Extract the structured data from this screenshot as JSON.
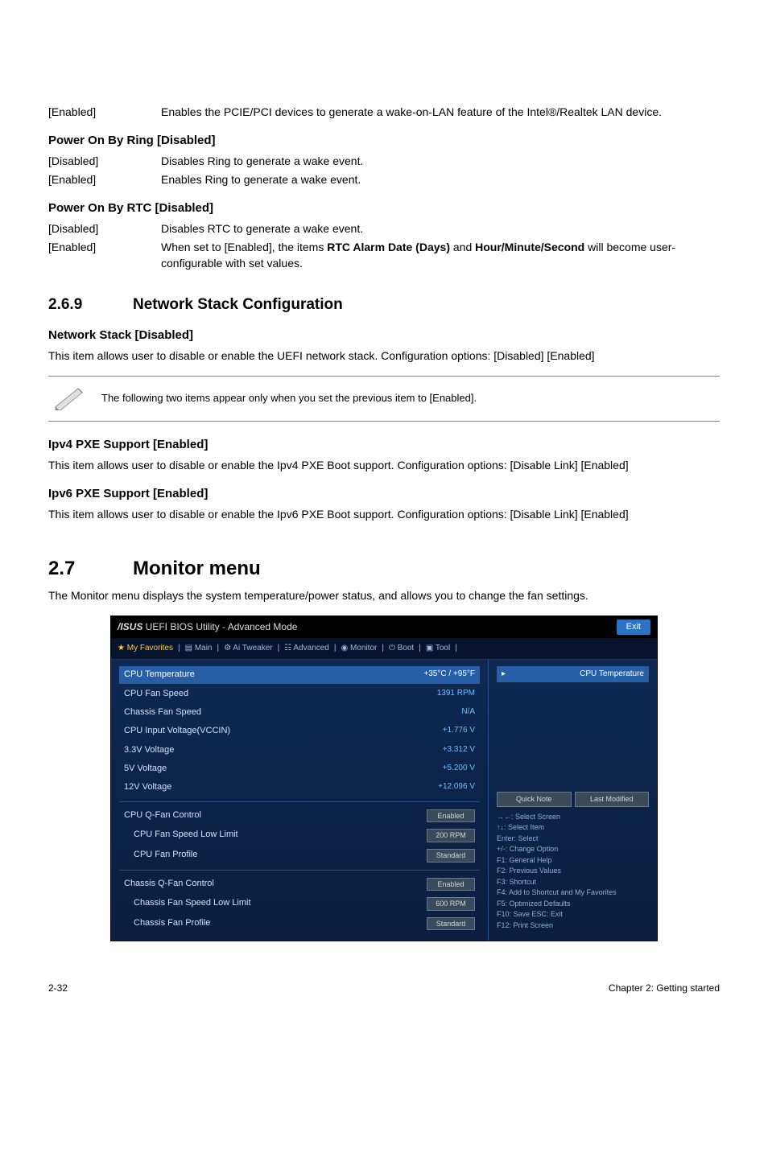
{
  "top": {
    "enabled_label": "[Enabled]",
    "enabled_desc": "Enables the PCIE/PCI devices to generate a wake-on-LAN feature of the Intel®/Realtek LAN device."
  },
  "ring": {
    "heading": "Power On By Ring [Disabled]",
    "disabled_label": "[Disabled]",
    "disabled_desc": "Disables Ring to generate a wake event.",
    "enabled_label": "[Enabled]",
    "enabled_desc": "Enables Ring to generate a wake event."
  },
  "rtc": {
    "heading": "Power On By RTC [Disabled]",
    "disabled_label": "[Disabled]",
    "disabled_desc": "Disables RTC to generate a wake event.",
    "enabled_label": "[Enabled]",
    "enabled_desc_prefix": "When set to [Enabled], the items ",
    "enabled_bold1": "RTC Alarm Date (Days)",
    "enabled_mid": " and ",
    "enabled_bold2": "Hour/Minute/Second",
    "enabled_suffix": " will become user-configurable with set values."
  },
  "s269": {
    "num": "2.6.9",
    "title": "Network Stack Configuration"
  },
  "netstack": {
    "heading": "Network Stack [Disabled]",
    "desc": "This item allows user to disable or enable the UEFI network stack. Configuration options: [Disabled] [Enabled]"
  },
  "note": {
    "text": "The following two items appear only when you set the previous item to [Enabled]."
  },
  "ipv4": {
    "heading": "Ipv4 PXE Support [Enabled]",
    "desc": "This item allows user to disable or enable the Ipv4 PXE Boot support. Configuration options: [Disable Link] [Enabled]"
  },
  "ipv6": {
    "heading": "Ipv6 PXE Support [Enabled]",
    "desc": "This item allows user to disable or enable the Ipv6 PXE Boot support. Configuration options: [Disable Link] [Enabled]"
  },
  "s27": {
    "num": "2.7",
    "title": "Monitor menu",
    "desc": "The Monitor menu displays the system temperature/power status, and allows you to change the fan settings."
  },
  "bios": {
    "title_brand": "/ISUS",
    "title_rest": " UEFI BIOS Utility - Advanced Mode",
    "exit": "Exit",
    "tabs": {
      "fav": "★ My Favorites",
      "main": "▤ Main",
      "tweak": "⚙ Ai Tweaker",
      "adv": "☷ Advanced",
      "mon": "◉ Monitor",
      "boot": "⏻ Boot",
      "tool": "▣ Tool"
    },
    "rows": {
      "cpu_temp_l": "CPU Temperature",
      "cpu_temp_v": "+35°C / +95°F",
      "cpu_fan_l": "CPU Fan Speed",
      "cpu_fan_v": "1391 RPM",
      "cha_fan_l": "Chassis Fan Speed",
      "cha_fan_v": "N/A",
      "cpu_volt_l": "CPU Input Voltage(VCCIN)",
      "cpu_volt_v": "+1.776 V",
      "v33_l": "3.3V Voltage",
      "v33_v": "+3.312 V",
      "v5_l": "5V Voltage",
      "v5_v": "+5.200 V",
      "v12_l": "12V Voltage",
      "v12_v": "+12.096 V",
      "qfan_l": "CPU Q-Fan Control",
      "qfan_v": "Enabled",
      "low_l": "CPU Fan Speed Low Limit",
      "low_v": "200 RPM",
      "prof_l": "CPU Fan Profile",
      "prof_v": "Standard",
      "cha_qfan_l": "Chassis Q-Fan Control",
      "cha_qfan_v": "Enabled",
      "cha_low_l": "Chassis Fan Speed Low Limit",
      "cha_low_v": "600 RPM",
      "cha_prof_l": "Chassis Fan Profile",
      "cha_prof_v": "Standard"
    },
    "right": {
      "head_l": "CPU Temperature",
      "btn1": "Quick Note",
      "btn2": "Last Modified",
      "help": "→←: Select Screen\n↑↓: Select Item\nEnter: Select\n+/-: Change Option\nF1: General Help\nF2: Previous Values\nF3: Shortcut\nF4: Add to Shortcut and My Favorites\nF5: Optimized Defaults\nF10: Save  ESC: Exit\nF12: Print Screen"
    }
  },
  "footer": {
    "left": "2-32",
    "right": "Chapter 2: Getting started"
  }
}
